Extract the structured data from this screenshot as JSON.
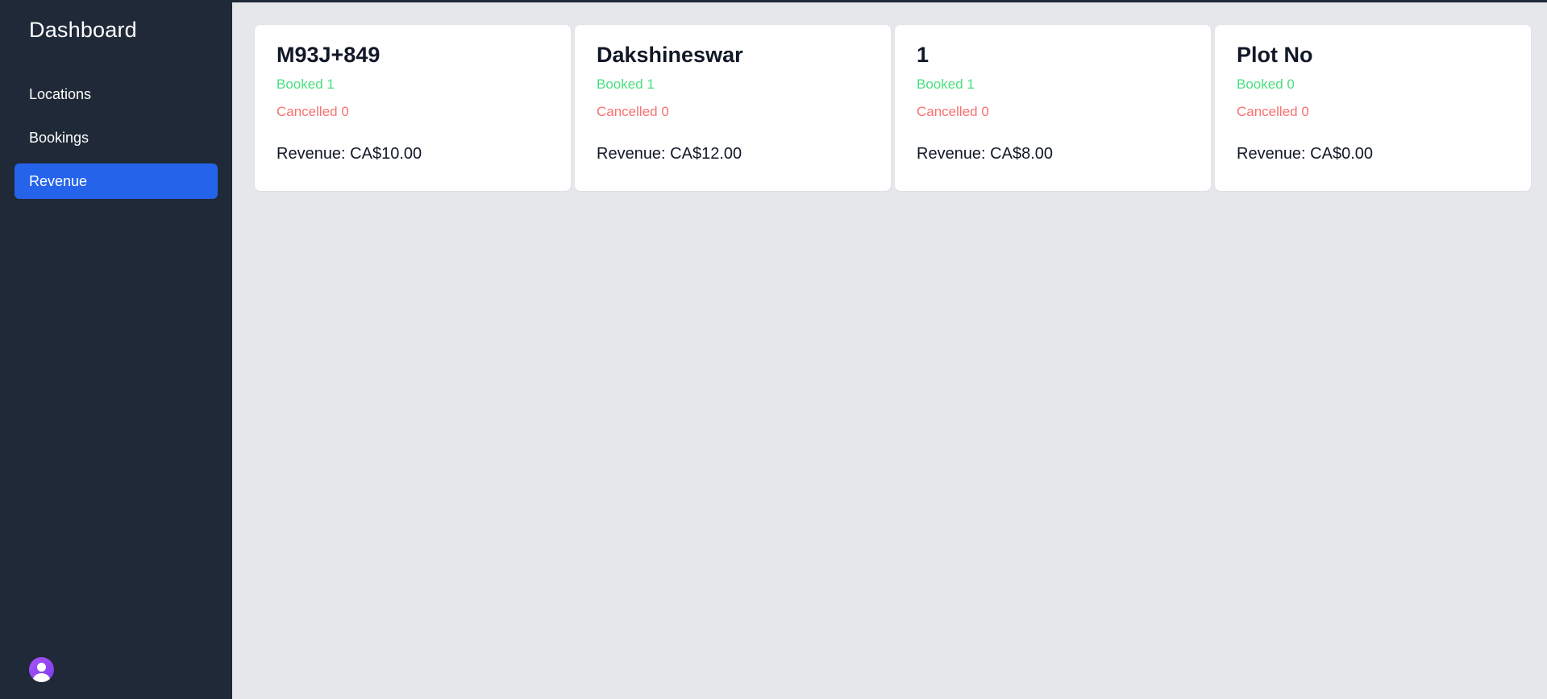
{
  "sidebar": {
    "title": "Dashboard",
    "nav": [
      {
        "label": "Locations",
        "active": false
      },
      {
        "label": "Bookings",
        "active": false
      },
      {
        "label": "Revenue",
        "active": true
      }
    ],
    "avatar_icon": "user-avatar-icon"
  },
  "cards": [
    {
      "title": "M93J+849",
      "booked": "Booked 1",
      "cancelled": "Cancelled 0",
      "revenue": "Revenue: CA$10.00"
    },
    {
      "title": "Dakshineswar",
      "booked": "Booked 1",
      "cancelled": "Cancelled 0",
      "revenue": "Revenue: CA$12.00"
    },
    {
      "title": "1",
      "booked": "Booked 1",
      "cancelled": "Cancelled 0",
      "revenue": "Revenue: CA$8.00"
    },
    {
      "title": "Plot No",
      "booked": "Booked 0",
      "cancelled": "Cancelled 0",
      "revenue": "Revenue: CA$0.00"
    }
  ],
  "colors": {
    "sidebar_bg": "#1f2937",
    "active_nav": "#2563eb",
    "booked": "#4ade80",
    "cancelled": "#f87171",
    "page_bg": "#e5e7eb"
  }
}
